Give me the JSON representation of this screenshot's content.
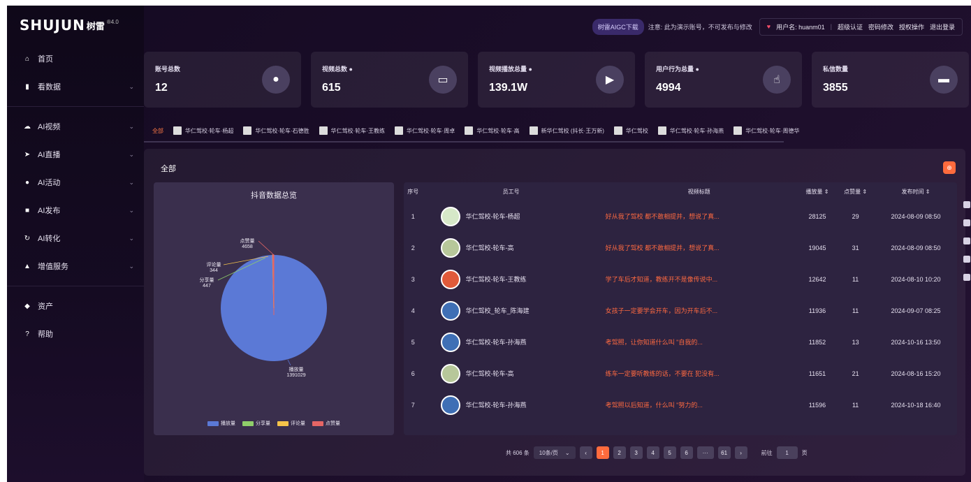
{
  "logo": {
    "brand": "SHUJUN",
    "sub": "树雷",
    "version": "®4.0"
  },
  "sidebar": {
    "items": [
      {
        "label": "首页",
        "icon": "home-icon",
        "glyph": "⌂",
        "chevron": false
      },
      {
        "label": "看数据",
        "icon": "bar-chart-icon",
        "glyph": "▮",
        "chevron": true
      },
      {
        "label": "AI视频",
        "icon": "video-icon",
        "glyph": "☁",
        "chevron": true
      },
      {
        "label": "AI直播",
        "icon": "send-icon",
        "glyph": "➤",
        "chevron": true
      },
      {
        "label": "AI活动",
        "icon": "location-icon",
        "glyph": "●",
        "chevron": true
      },
      {
        "label": "AI发布",
        "icon": "publish-icon",
        "glyph": "■",
        "chevron": true
      },
      {
        "label": "AI转化",
        "icon": "refresh-icon",
        "glyph": "↻",
        "chevron": true
      },
      {
        "label": "增值服务",
        "icon": "user-icon",
        "glyph": "▲",
        "chevron": true
      },
      {
        "label": "资产",
        "icon": "asset-icon",
        "glyph": "◆",
        "chevron": false
      },
      {
        "label": "帮助",
        "icon": "help-icon",
        "glyph": "?",
        "chevron": false
      }
    ]
  },
  "topbar": {
    "aigc_label": "树雷AIGC下载",
    "note": "注意: 此为演示账号，不可发布与修改",
    "user_label": "用户名: huanm01",
    "links": [
      "超级认证",
      "密码修改",
      "授权操作",
      "退出登录"
    ]
  },
  "cards": [
    {
      "title": "账号总数",
      "value": "12",
      "icon": "person-icon",
      "glyph": "●"
    },
    {
      "title": "视频总数 ●",
      "value": "615",
      "icon": "camera-icon",
      "glyph": "▭"
    },
    {
      "title": "视频播放总量 ●",
      "value": "139.1W",
      "icon": "video-camera-icon",
      "glyph": "▶"
    },
    {
      "title": "用户行为总量 ●",
      "value": "4994",
      "icon": "hand-icon",
      "glyph": "☝"
    },
    {
      "title": "私信数量",
      "value": "3855",
      "icon": "message-icon",
      "glyph": "▬"
    }
  ],
  "tabs": [
    {
      "label": "全部",
      "active": true
    },
    {
      "label": "华仁驾校·轮车·杨超"
    },
    {
      "label": "华仁驾校·轮车·石德胜"
    },
    {
      "label": "华仁驾校·轮车·王教练"
    },
    {
      "label": "华仁驾校·轮车·周卓"
    },
    {
      "label": "华仁驾校·轮车·高"
    },
    {
      "label": "新华仁驾校 (抖长·王万新)"
    },
    {
      "label": "华仁驾校"
    },
    {
      "label": "华仁驾校·轮车·孙海燕"
    },
    {
      "label": "华仁驾校·轮车·周德华"
    }
  ],
  "panel": {
    "title": "全部",
    "badge": "⊕"
  },
  "chart": {
    "title": "抖音数据总览",
    "labels": [
      {
        "name": "点赞量",
        "value": "4658"
      },
      {
        "name": "评论量",
        "value": "344"
      },
      {
        "name": "分享量",
        "value": "447"
      },
      {
        "name": "播放量",
        "value": "1391029"
      }
    ],
    "legend": [
      {
        "name": "播放量",
        "color": "#5b79d6"
      },
      {
        "name": "分享量",
        "color": "#8fce6a"
      },
      {
        "name": "评论量",
        "color": "#f5c34a"
      },
      {
        "name": "点赞量",
        "color": "#e56565"
      }
    ]
  },
  "chart_data": {
    "type": "pie",
    "title": "抖音数据总览",
    "categories": [
      "播放量",
      "分享量",
      "评论量",
      "点赞量"
    ],
    "values": [
      1391029,
      447,
      344,
      4658
    ],
    "legend_position": "bottom"
  },
  "table": {
    "headers": [
      "序号",
      "员工号",
      "视频标题",
      "播放量 ⇕",
      "点赞量 ⇕",
      "发布时间 ⇕"
    ],
    "rows": [
      {
        "idx": "1",
        "emp": "华仁驾校-轮车-杨超",
        "title": "好从我了驾校 都不敢相提并，想说了真...",
        "plays": "28125",
        "likes": "29",
        "time": "2024-08-09 08:50",
        "av": "#d6e8c8"
      },
      {
        "idx": "2",
        "emp": "华仁驾校-轮车-高",
        "title": "好从我了驾校 都不敢相提并，想说了真...",
        "plays": "19045",
        "likes": "31",
        "time": "2024-08-09 08:50",
        "av": "#b7c79a"
      },
      {
        "idx": "3",
        "emp": "华仁驾校-轮车-王教练",
        "title": "学了车后才知道，教练开不是像传说中...",
        "plays": "12642",
        "likes": "11",
        "time": "2024-08-10 10:20",
        "av": "#e05a3a"
      },
      {
        "idx": "4",
        "emp": "华仁驾校_轮车_陈海建",
        "title": "女孩子一定要学会开车，因为开车后不...",
        "plays": "11936",
        "likes": "11",
        "time": "2024-09-07 08:25",
        "av": "#3f6fb5"
      },
      {
        "idx": "5",
        "emp": "华仁驾校-轮车-孙海燕",
        "title": "考驾照，让你知道什么叫 \"自我的...",
        "plays": "11852",
        "likes": "13",
        "time": "2024-10-16 13:50",
        "av": "#3f6fb5"
      },
      {
        "idx": "6",
        "emp": "华仁驾校-轮车-高",
        "title": "练车一定要听教练的话，不要在 犯没有...",
        "plays": "11651",
        "likes": "21",
        "time": "2024-08-16 15:20",
        "av": "#b7c79a"
      },
      {
        "idx": "7",
        "emp": "华仁驾校-轮车-孙海燕",
        "title": "考驾照以后知道，什么叫 \"努力的...",
        "plays": "11596",
        "likes": "11",
        "time": "2024-10-18 16:40",
        "av": "#3f6fb5"
      }
    ]
  },
  "pager": {
    "total": "共 606 条",
    "page_size": "10条/页",
    "pages": [
      "1",
      "2",
      "3",
      "4",
      "5",
      "6",
      "···",
      "61"
    ],
    "goto_label": "前往",
    "goto_value": "1",
    "goto_suffix": "页"
  }
}
